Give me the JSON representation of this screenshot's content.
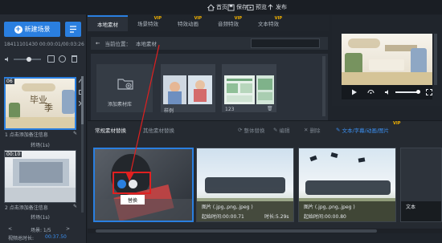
{
  "topbar": {
    "home": "首页",
    "save": "保存",
    "preview": "预览",
    "publish": "发布"
  },
  "sidebar": {
    "new_scene": "新建场景",
    "time_info": "18411101430 00:00:01/00:03:26",
    "scenes": [
      {
        "number": "06",
        "caption": "点击添加备注信息",
        "thumb_text_a": "毕业",
        "thumb_text_b": "季",
        "index": "1"
      },
      {
        "number": "00:10",
        "caption": "点击添加备注信息",
        "index": "2"
      }
    ],
    "transition_label": "转场(1s)",
    "transition_label_2": "转场(1s)",
    "pager": "场景: 1/5",
    "total_duration_label": "视频总时长:",
    "total_duration": "00:37.50"
  },
  "tabs": [
    {
      "label": "本地素材",
      "vip": ""
    },
    {
      "label": "场景特效",
      "vip": "VIP"
    },
    {
      "label": "特效动画",
      "vip": "VIP"
    },
    {
      "label": "音频特效",
      "vip": "VIP"
    },
    {
      "label": "文本特效",
      "vip": "VIP"
    }
  ],
  "location": {
    "label": "当前位置：",
    "path": "本地素材"
  },
  "media": {
    "add_folder": "添加素材库",
    "items": [
      {
        "name": "样例"
      },
      {
        "name": "123"
      }
    ]
  },
  "elements": {
    "tab_common": "常规素材替换",
    "tab_other": "其他素材替换",
    "tool_ai": "整体替换",
    "tool_crop": "编辑",
    "tool_delete": "删除",
    "text_tab": "文本/字幕/动画/图片",
    "vip": "VIP"
  },
  "clips": [
    {
      "type": "",
      "start": "",
      "duration": "",
      "replace": "替换"
    },
    {
      "type": "图片 (.jpg,.png,.jpeg )",
      "start": "起始时间:00:00.71",
      "duration": "时长:5.29s"
    },
    {
      "type": "图片 (.jpg,.png,.jpeg )",
      "start": "起始时间:00:00.80",
      "duration": ""
    },
    {
      "type": "文本",
      "start": "",
      "duration": ""
    }
  ],
  "colors": {
    "accent": "#2a7fe0",
    "vip": "#f2b200",
    "annotation": "#e02020"
  }
}
